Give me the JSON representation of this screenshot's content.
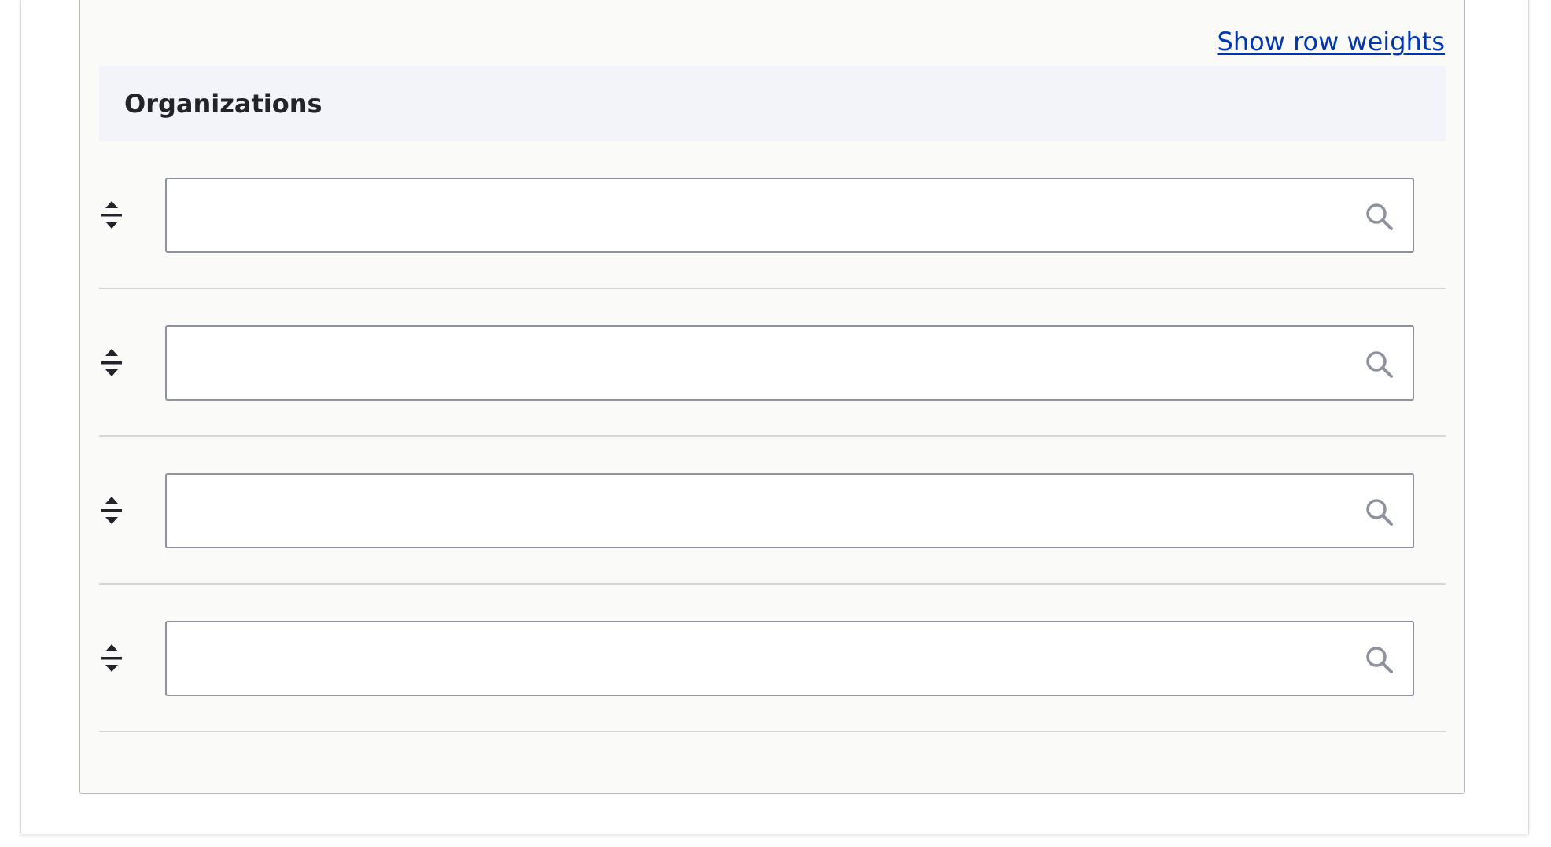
{
  "toolbar": {
    "show_row_weights_label": "Show row weights"
  },
  "table": {
    "header_title": "Organizations",
    "rows": [
      {
        "value": "",
        "placeholder": ""
      },
      {
        "value": "",
        "placeholder": ""
      },
      {
        "value": "",
        "placeholder": ""
      },
      {
        "value": "",
        "placeholder": ""
      }
    ]
  },
  "icons": {
    "drag": "drag-handle-icon",
    "search": "search-icon"
  },
  "colors": {
    "link": "#0036b1",
    "header_bg": "#f3f4f9",
    "fieldset_bg": "#fafaf9",
    "input_border": "#8e929c",
    "icon_gray": "#8e929c",
    "text_dark": "#232429"
  }
}
